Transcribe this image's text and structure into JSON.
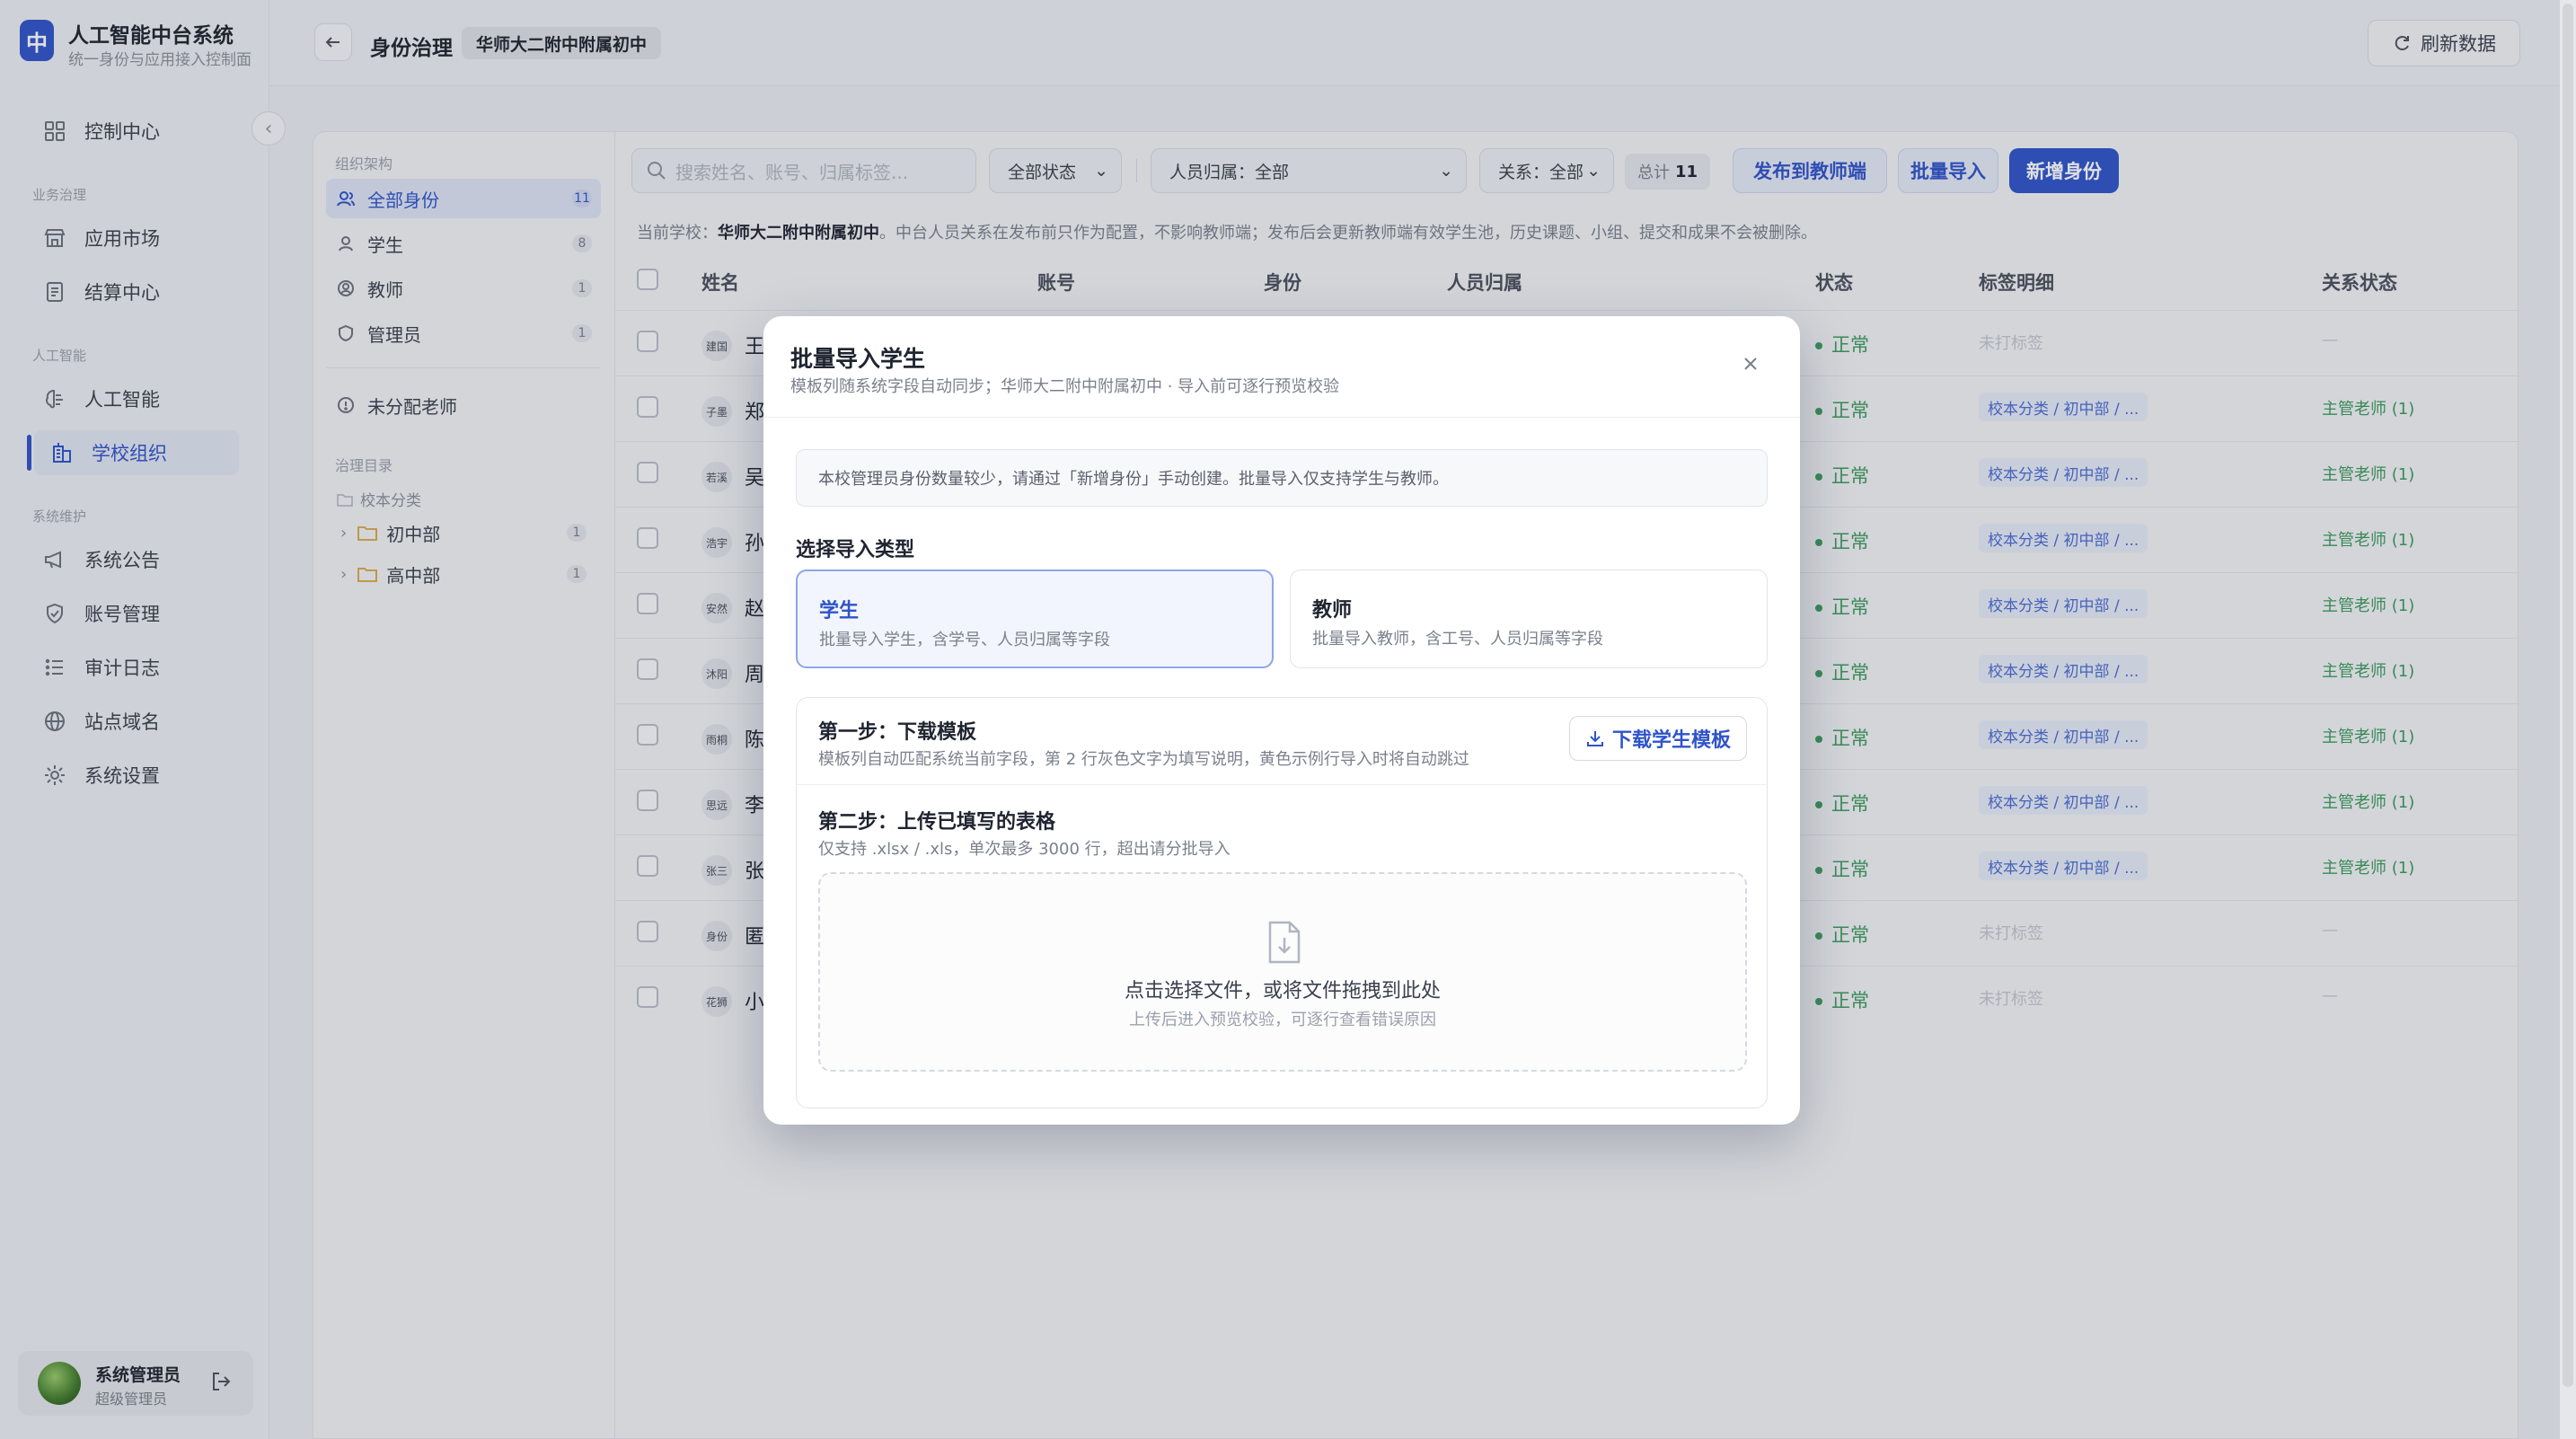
{
  "app": {
    "logo_char": "中",
    "title": "人工智能中台系统",
    "subtitle": "统一身份与应用接入控制面"
  },
  "sidebar": {
    "collapse_icon": "chevron-left-icon",
    "groups": [
      {
        "label": "业务治理"
      },
      {
        "label": "人工智能"
      },
      {
        "label": "系统维护"
      }
    ],
    "items": [
      {
        "label": "控制中心",
        "icon": "dashboard-icon"
      },
      {
        "label": "应用市场",
        "icon": "store-icon"
      },
      {
        "label": "结算中心",
        "icon": "document-icon"
      },
      {
        "label": "人工智能",
        "icon": "brain-icon"
      },
      {
        "label": "学校组织",
        "icon": "building-icon"
      },
      {
        "label": "系统公告",
        "icon": "megaphone-icon"
      },
      {
        "label": "账号管理",
        "icon": "shield-icon"
      },
      {
        "label": "审计日志",
        "icon": "list-icon"
      },
      {
        "label": "站点域名",
        "icon": "globe-icon"
      },
      {
        "label": "系统设置",
        "icon": "gear-icon"
      }
    ],
    "active_index": 4
  },
  "user": {
    "name": "系统管理员",
    "role": "超级管理员"
  },
  "header": {
    "title": "身份治理",
    "school": "华师大二附中附属初中",
    "refresh_label": "刷新数据"
  },
  "tree": {
    "section_org": "组织架构",
    "items": [
      {
        "label": "全部身份",
        "count": "11"
      },
      {
        "label": "学生",
        "count": "8"
      },
      {
        "label": "教师",
        "count": "1"
      },
      {
        "label": "管理员",
        "count": "1"
      }
    ],
    "unassigned": "未分配老师",
    "section_catalog": "治理目录",
    "catalog_root": "校本分类",
    "folders": [
      {
        "label": "初中部",
        "count": "1"
      },
      {
        "label": "高中部",
        "count": "1"
      }
    ]
  },
  "toolbar": {
    "search_placeholder": "搜索姓名、账号、归属标签...",
    "status_select": "全部状态",
    "belong_select": "人员归属：全部",
    "relation_select": "关系：全部",
    "total_label": "总计",
    "total_value": "11",
    "publish_label": "发布到教师端",
    "import_label": "批量导入",
    "add_label": "新增身份"
  },
  "notice": {
    "prefix": "当前学校：",
    "school": "华师大二附中附属初中",
    "text": "。中台人员关系在发布前只作为配置，不影响教师端；发布后会更新教师端有效学生池，历史课题、小组、提交和成果不会被删除。"
  },
  "table": {
    "columns": [
      "姓名",
      "账号",
      "身份",
      "人员归属",
      "状态",
      "标签明细",
      "关系状态"
    ],
    "rows": [
      {
        "avatar": "建国",
        "name": "王",
        "status": "正常",
        "tag": "未打标签",
        "relation": "—",
        "tagged": false
      },
      {
        "avatar": "子墨",
        "name": "郑",
        "status": "正常",
        "tag": "校本分类 / 初中部 / ...",
        "relation": "主管老师 (1)",
        "tagged": true
      },
      {
        "avatar": "若溪",
        "name": "吴",
        "status": "正常",
        "tag": "校本分类 / 初中部 / ...",
        "relation": "主管老师 (1)",
        "tagged": true
      },
      {
        "avatar": "浩宇",
        "name": "孙",
        "status": "正常",
        "tag": "校本分类 / 初中部 / ...",
        "relation": "主管老师 (1)",
        "tagged": true
      },
      {
        "avatar": "安然",
        "name": "赵",
        "status": "正常",
        "tag": "校本分类 / 初中部 / ...",
        "relation": "主管老师 (1)",
        "tagged": true
      },
      {
        "avatar": "沐阳",
        "name": "周",
        "status": "正常",
        "tag": "校本分类 / 初中部 / ...",
        "relation": "主管老师 (1)",
        "tagged": true
      },
      {
        "avatar": "雨桐",
        "name": "陈",
        "status": "正常",
        "tag": "校本分类 / 初中部 / ...",
        "relation": "主管老师 (1)",
        "tagged": true
      },
      {
        "avatar": "思远",
        "name": "李",
        "status": "正常",
        "tag": "校本分类 / 初中部 / ...",
        "relation": "主管老师 (1)",
        "tagged": true
      },
      {
        "avatar": "张三",
        "name": "张",
        "status": "正常",
        "tag": "校本分类 / 初中部 / ...",
        "relation": "主管老师 (1)",
        "tagged": true
      },
      {
        "avatar": "身份",
        "name": "匿",
        "status": "正常",
        "tag": "未打标签",
        "relation": "—",
        "tagged": false
      },
      {
        "avatar": "花狮",
        "name": "小",
        "status": "正常",
        "tag": "未打标签",
        "relation": "—",
        "tagged": false
      }
    ]
  },
  "modal": {
    "title": "批量导入学生",
    "subtitle": "模板列随系统字段自动同步；华师大二附中附属初中 · 导入前可逐行预览校验",
    "info": "本校管理员身份数量较少，请通过「新增身份」手动创建。批量导入仅支持学生与教师。",
    "type_section": "选择导入类型",
    "types": [
      {
        "title": "学生",
        "desc": "批量导入学生，含学号、人员归属等字段",
        "selected": true
      },
      {
        "title": "教师",
        "desc": "批量导入教师，含工号、人员归属等字段",
        "selected": false
      }
    ],
    "step1_title": "第一步：下载模板",
    "step1_desc": "模板列自动匹配系统当前字段，第 2 行灰色文字为填写说明，黄色示例行导入时将自动跳过",
    "download_label": "下载学生模板",
    "step2_title": "第二步：上传已填写的表格",
    "step2_desc": "仅支持 .xlsx / .xls，单次最多 3000 行，超出请分批导入",
    "drop_text": "点击选择文件，或将文件拖拽到此处",
    "drop_sub": "上传后进入预览校验，可逐行查看错误原因"
  }
}
